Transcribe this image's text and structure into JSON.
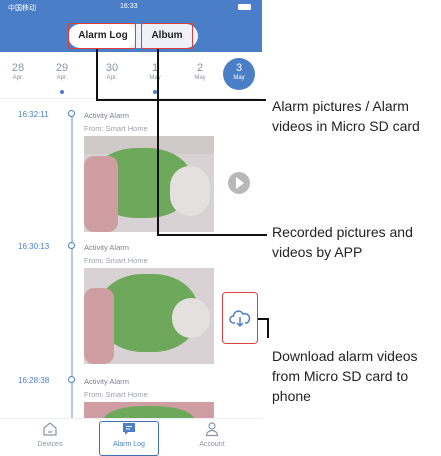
{
  "status_bar": {
    "carrier": "中国移动",
    "time": "16:33"
  },
  "tabs": {
    "alarm_log": "Alarm Log",
    "album": "Album"
  },
  "dates": [
    {
      "day": "28",
      "month": "Apr.",
      "has_events": false
    },
    {
      "day": "29",
      "month": "Apr.",
      "has_events": true
    },
    {
      "day": "30",
      "month": "Apr.",
      "has_events": false
    },
    {
      "day": "1",
      "month": "May",
      "has_events": true
    },
    {
      "day": "2",
      "month": "May",
      "has_events": false
    },
    {
      "day": "3",
      "month": "May",
      "has_events": false,
      "selected": true
    }
  ],
  "events": [
    {
      "time": "16:32:11",
      "title": "Activity Alarm",
      "from": "From: Smart Home"
    },
    {
      "time": "16:30:13",
      "title": "Activity Alarm",
      "from": "From: Smart Home"
    },
    {
      "time": "16:28:38",
      "title": "Activity Alarm",
      "from": "From: Smart Home"
    }
  ],
  "bottom_nav": {
    "devices": "Devices",
    "alarm_log": "Alarm Log",
    "account": "Account"
  },
  "annotations": {
    "alarm_log_note_line1": "Alarm pictures / Alarm",
    "alarm_log_note_line2": "videos in Micro SD card",
    "album_note_line1": "Recorded pictures and",
    "album_note_line2": "videos by APP",
    "download_note_line1": "Download alarm videos",
    "download_note_line2": "from Micro SD card to",
    "download_note_line3": "phone"
  },
  "colors": {
    "brand_blue": "#4a7fc8",
    "highlight_red": "#d94141",
    "thumbnail_green": "#6ea85a"
  },
  "icons": {
    "play": "play-icon",
    "download": "cloud-download-icon",
    "devices": "home-icon",
    "alarm_log": "message-icon",
    "account": "person-icon"
  }
}
